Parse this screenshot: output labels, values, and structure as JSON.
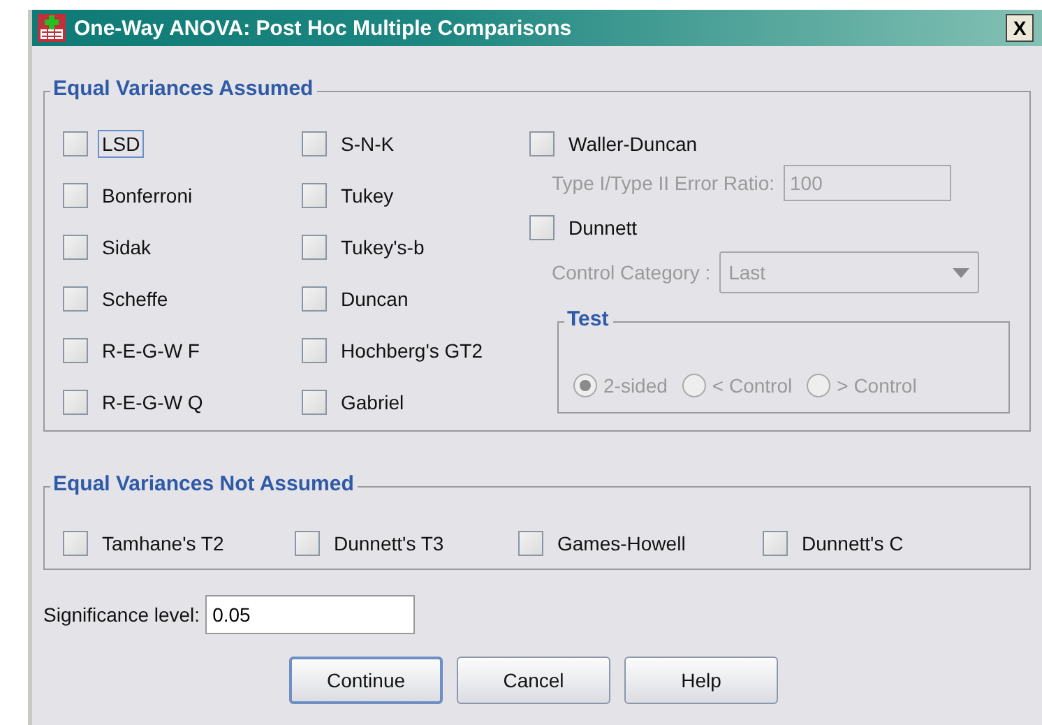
{
  "window": {
    "title": "One-Way ANOVA: Post Hoc Multiple Comparisons",
    "close": "X"
  },
  "equal_variances_assumed": {
    "legend": "Equal Variances Assumed",
    "columns": [
      [
        {
          "label": "LSD",
          "checked": false,
          "focused": true
        },
        {
          "label": "Bonferroni",
          "checked": false,
          "focused": false
        },
        {
          "label": "Sidak",
          "checked": false,
          "focused": false
        },
        {
          "label": "Scheffe",
          "checked": false,
          "focused": false
        },
        {
          "label": "R-E-G-W F",
          "checked": false,
          "focused": false
        },
        {
          "label": "R-E-G-W Q",
          "checked": false,
          "focused": false
        }
      ],
      [
        {
          "label": "S-N-K",
          "checked": false,
          "focused": false
        },
        {
          "label": "Tukey",
          "checked": false,
          "focused": false
        },
        {
          "label": "Tukey's-b",
          "checked": false,
          "focused": false
        },
        {
          "label": "Duncan",
          "checked": false,
          "focused": false
        },
        {
          "label": "Hochberg's GT2",
          "checked": false,
          "focused": false
        },
        {
          "label": "Gabriel",
          "checked": false,
          "focused": false
        }
      ]
    ],
    "waller_duncan": {
      "label": "Waller-Duncan",
      "checked": false
    },
    "error_ratio": {
      "label": "Type I/Type II Error Ratio:",
      "value": "100",
      "disabled": true
    },
    "dunnett": {
      "label": "Dunnett",
      "checked": false
    },
    "control_category": {
      "label": "Control Category :",
      "value": "Last",
      "disabled": true
    },
    "test": {
      "legend": "Test",
      "disabled": true,
      "options": [
        {
          "label": "2-sided",
          "selected": true
        },
        {
          "label": "< Control",
          "selected": false
        },
        {
          "label": "> Control",
          "selected": false
        }
      ]
    }
  },
  "equal_variances_not_assumed": {
    "legend": "Equal Variances Not Assumed",
    "checkboxes": [
      {
        "label": "Tamhane's T2",
        "checked": false
      },
      {
        "label": "Dunnett's T3",
        "checked": false
      },
      {
        "label": "Games-Howell",
        "checked": false
      },
      {
        "label": "Dunnett's C",
        "checked": false
      }
    ]
  },
  "significance_level": {
    "label": "Significance level:",
    "value": "0.05"
  },
  "buttons": [
    {
      "label": "Continue",
      "default": true
    },
    {
      "label": "Cancel",
      "default": false
    },
    {
      "label": "Help",
      "default": false
    }
  ]
}
